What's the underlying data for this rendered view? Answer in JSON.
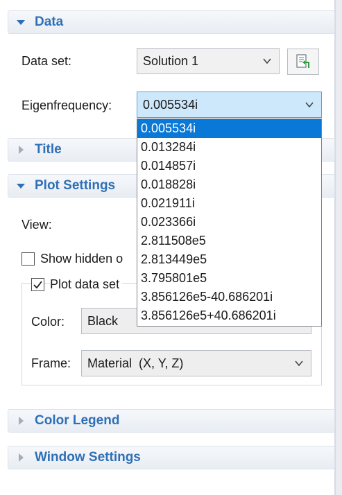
{
  "sections": {
    "data": {
      "title": "Data"
    },
    "title": {
      "title": "Title"
    },
    "plot_settings": {
      "title": "Plot Settings"
    },
    "color_legend": {
      "title": "Color Legend"
    },
    "window_settings": {
      "title": "Window Settings"
    }
  },
  "data_section": {
    "dataset_label": "Data set:",
    "dataset_value": "Solution 1",
    "eigenfrequency_label": "Eigenfrequency:",
    "eigenfrequency_value": "0.005534i"
  },
  "plot_settings_section": {
    "view_label": "View:",
    "show_hidden_label": "Show hidden o",
    "plot_dataset_label": "Plot data set",
    "color_label": "Color:",
    "color_value": "Black",
    "frame_label": "Frame:",
    "frame_value": "Material  (X, Y, Z)"
  },
  "eigenfrequency_options": [
    "0.005534i",
    "0.013284i",
    "0.014857i",
    "0.018828i",
    "0.021911i",
    "0.023366i",
    "2.811508e5",
    "2.813449e5",
    "3.795801e5",
    "3.856126e5-40.686201i",
    "3.856126e5+40.686201i"
  ],
  "icons": {
    "expanded": "triangle-down-icon",
    "collapsed": "triangle-right-icon",
    "dropdown": "chevron-down-icon",
    "refresh": "update-dataset-icon",
    "check": "checkmark-icon"
  },
  "colors": {
    "section_title": "#2e6fb6",
    "selection": "#0a78d7",
    "active_combo": "#cde8fb"
  }
}
